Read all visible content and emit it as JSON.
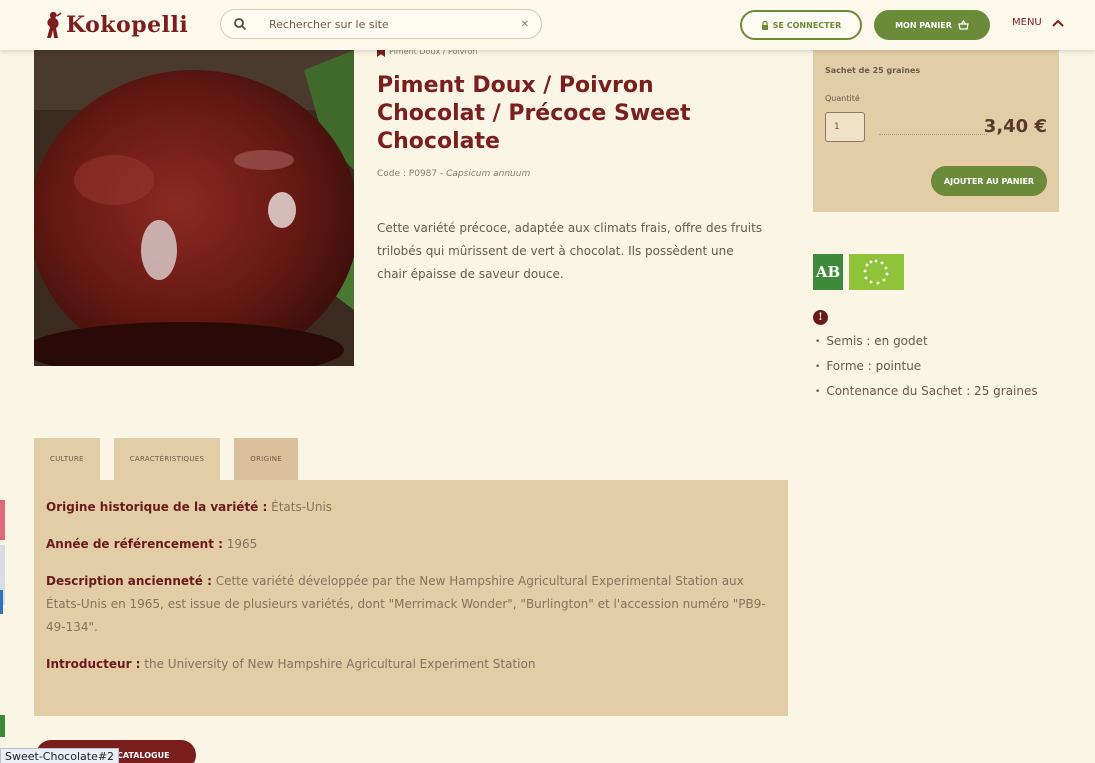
{
  "header": {
    "logo_text": "Kokopelli",
    "search_placeholder": "Rechercher sur le site",
    "search_clear": "✕",
    "connect_label": "SE CONNECTER",
    "cart_label": "MON PANIER",
    "menu_label": "MENU"
  },
  "product": {
    "breadcrumb": "Piment Doux / Poivron",
    "title": "Piment Doux / Poivron Chocolat / Précoce Sweet Chocolate",
    "code_label": "Code : P0987",
    "latin_name": "Capsicum annuum",
    "description": "Cette variété précoce, adaptée aux climats frais, offre des fruits trilobés qui mûrissent de vert à chocolat. Ils possèdent une chair épaisse de saveur douce."
  },
  "cart": {
    "sachet": "Sachet de 25 graines",
    "quantity_label": "Quantité",
    "quantity_value": "1",
    "price": "3,40 €",
    "add_button": "AJOUTER AU PANIER"
  },
  "badges": {
    "ab_label": "AB",
    "eu_label": "EU organic"
  },
  "features": [
    "Semis : en godet",
    "Forme : pointue",
    "Contenance du Sachet : 25 graines"
  ],
  "tabs": [
    "CULTURE",
    "CARACTÉRISTIQUES",
    "ORIGINE"
  ],
  "origin": {
    "rows": [
      {
        "label": "Origine historique de la variété :",
        "value": "États-Unis"
      },
      {
        "label": "Année de référencement :",
        "value": "1965"
      },
      {
        "label": "Description ancienneté :",
        "value": "Cette variété développée par the New Hampshire Agricultural Experimental Station aux États-Unis en 1965, est issue de plusieurs variétés, dont \"Merrimack Wonder\", \"Burlington\" et l'accession numéro \"PB9-49-134\"."
      },
      {
        "label": "Introducteur :",
        "value": "the University of New Hampshire Agricultural Experiment Station"
      }
    ]
  },
  "bottom": {
    "catalogue_button": "RETOUR AU CATALOGUE",
    "status_url": "Sweet-Chocolate#2"
  },
  "colors": {
    "accent": "#7a1e1e",
    "green": "#6b8a3a",
    "panel": "#e2cda6",
    "background": "#fbf5e6"
  },
  "icons": [
    "search-icon",
    "lock-icon",
    "basket-icon",
    "chevron-up-icon",
    "bookmark-icon",
    "info-icon"
  ]
}
